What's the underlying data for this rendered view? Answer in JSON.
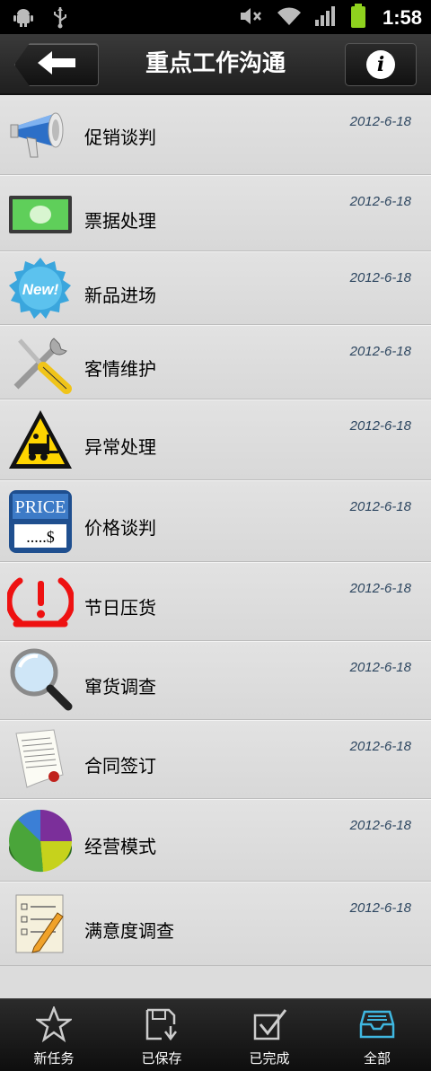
{
  "status": {
    "time": "1:58"
  },
  "header": {
    "title": "重点工作沟通"
  },
  "items": [
    {
      "label": "促销谈判",
      "date": "2012-6-18",
      "icon": "megaphone-icon"
    },
    {
      "label": "票据处理",
      "date": "2012-6-18",
      "icon": "banknote-icon"
    },
    {
      "label": "新品进场",
      "date": "2012-6-18",
      "icon": "new-badge-icon"
    },
    {
      "label": "客情维护",
      "date": "2012-6-18",
      "icon": "tools-icon"
    },
    {
      "label": "异常处理",
      "date": "2012-6-18",
      "icon": "warning-forklift-icon"
    },
    {
      "label": "价格谈判",
      "date": "2012-6-18",
      "icon": "price-tag-icon"
    },
    {
      "label": "节日压货",
      "date": "2012-6-18",
      "icon": "alert-gauge-icon"
    },
    {
      "label": "窜货调查",
      "date": "2012-6-18",
      "icon": "magnifier-icon"
    },
    {
      "label": "合同签订",
      "date": "2012-6-18",
      "icon": "contract-icon"
    },
    {
      "label": "经营模式",
      "date": "2012-6-18",
      "icon": "pie-chart-icon"
    },
    {
      "label": "满意度调查",
      "date": "2012-6-18",
      "icon": "checklist-icon"
    }
  ],
  "tabs": [
    {
      "label": "新任务",
      "icon": "star-icon"
    },
    {
      "label": "已保存",
      "icon": "save-icon"
    },
    {
      "label": "已完成",
      "icon": "check-box-icon"
    },
    {
      "label": "全部",
      "icon": "inbox-icon",
      "active": true
    }
  ],
  "colors": {
    "active_tab": "#3fb7e0",
    "date_text": "#2d4660"
  }
}
